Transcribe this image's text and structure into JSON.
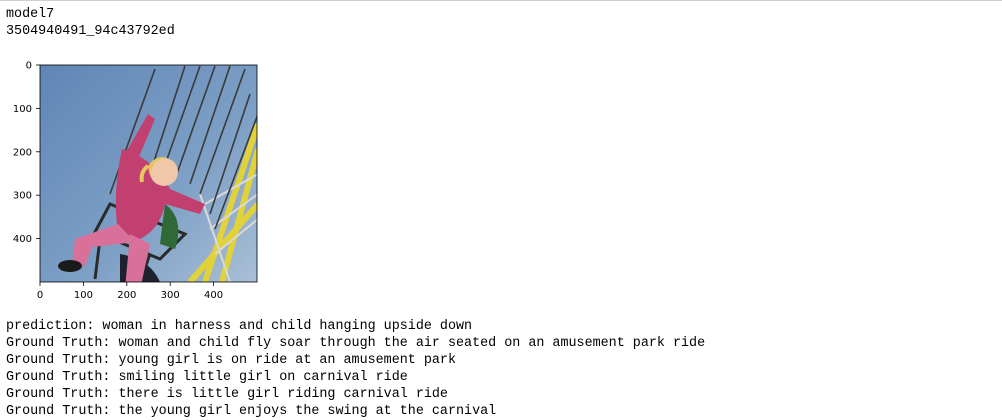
{
  "header": {
    "model": "model7",
    "image_id": "3504940491_94c43792ed"
  },
  "plot": {
    "x_ticks": [
      "0",
      "100",
      "200",
      "300",
      "400"
    ],
    "y_ticks": [
      "0",
      "100",
      "200",
      "300",
      "400"
    ],
    "x_tick_values": [
      0,
      100,
      200,
      300,
      400
    ],
    "y_tick_values": [
      0,
      100,
      200,
      300,
      400
    ],
    "extent": [
      0,
      500
    ],
    "image_subject": "girl-on-swing-ride-photo"
  },
  "captions": {
    "prediction": "prediction: woman in harness and child hanging upside down",
    "ground_truth": [
      "Ground Truth: woman and child fly soar through the air seated on an amusement park ride",
      "Ground Truth: young girl is on ride at an amusement park",
      "Ground Truth: smiling little girl on carnival ride",
      "Ground Truth: there is little girl riding carnival ride",
      "Ground Truth: the young girl enjoys the swing at the carnival"
    ]
  }
}
